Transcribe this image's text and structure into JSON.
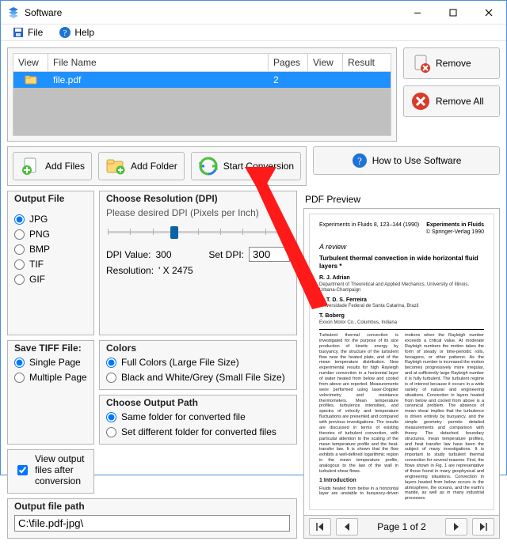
{
  "window": {
    "title": "Software"
  },
  "menu": {
    "file": "File",
    "help": "Help"
  },
  "list": {
    "headers": {
      "view": "View",
      "file_name": "File Name",
      "pages": "Pages",
      "view2": "View",
      "result": "Result"
    },
    "rows": [
      {
        "file_name": "file.pdf",
        "pages": "2",
        "result": ""
      }
    ]
  },
  "side": {
    "remove": "Remove",
    "remove_all": "Remove All"
  },
  "actions": {
    "add_files": "Add Files",
    "add_folder": "Add Folder",
    "start_conversion": "Start Conversion",
    "how_to": "How to Use Software"
  },
  "output_file": {
    "legend": "Output File",
    "options": {
      "jpg": "JPG",
      "png": "PNG",
      "bmp": "BMP",
      "tif": "TIF",
      "gif": "GIF"
    },
    "selected": "jpg"
  },
  "resolution": {
    "legend": "Choose Resolution (DPI)",
    "hint": "Please desired DPI (Pixels per Inch)",
    "dpi_value_label": "DPI Value:",
    "dpi_value": "300",
    "set_dpi_label": "Set DPI:",
    "set_dpi_value": "300",
    "resolution_label": "Resolution:",
    "resolution_value": "' X 2475"
  },
  "save_tiff": {
    "legend": "Save TIFF File:",
    "single": "Single Page",
    "multiple": "Multiple Page",
    "selected": "single"
  },
  "colors": {
    "legend": "Colors",
    "full": "Full Colors (Large File Size)",
    "bw": "Black and White/Grey (Small File Size)",
    "selected": "full"
  },
  "output_path": {
    "legend": "Choose Output Path",
    "same": "Same folder for converted file",
    "different": "Set different folder for converted files",
    "selected": "same"
  },
  "view_after": {
    "label": "View output files after conversion",
    "checked": true
  },
  "path": {
    "legend": "Output file path",
    "value": "C:\\file.pdf-jpg\\"
  },
  "preview": {
    "title": "PDF Preview",
    "pager_label": "Page 1 of 2",
    "doc": {
      "journal_left": "Experiments in Fluids 8, 123–144 (1990)",
      "journal_right": "Experiments in Fluids",
      "pub_right": "© Springer-Verlag 1990",
      "title": "A review",
      "subtitle": "Turbulent thermal convection in wide horizontal fluid layers *",
      "author1": "R. J. Adrian",
      "affil1": "Department of Theoretical and Applied Mechanics, University of Illinois, Urbana-Champaign",
      "author2": "R. T. D. S. Ferreira",
      "affil2": "Universidade Federal de Santa Catarina, Brazil",
      "author3": "T. Boberg",
      "affil3": "Exxon Motor Co., Columbus, Indiana",
      "section1": "1 Introduction"
    }
  }
}
